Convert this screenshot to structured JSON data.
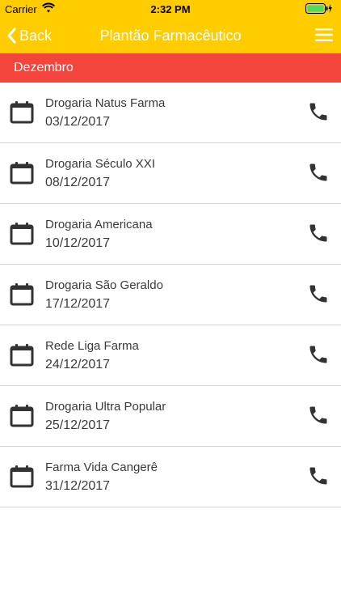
{
  "status": {
    "carrier": "Carrier",
    "time": "2:32 PM"
  },
  "nav": {
    "back_label": "Back",
    "title": "Plantão Farmacêutico"
  },
  "section": {
    "month": "Dezembro"
  },
  "colors": {
    "bar": "#FFCC00",
    "section": "#F3453B"
  },
  "items": [
    {
      "name": "Drogaria Natus Farma",
      "date": "03/12/2017"
    },
    {
      "name": "Drogaria Século XXI",
      "date": "08/12/2017"
    },
    {
      "name": "Drogaria Americana",
      "date": "10/12/2017"
    },
    {
      "name": "Drogaria São Geraldo",
      "date": "17/12/2017"
    },
    {
      "name": "Rede Liga Farma",
      "date": "24/12/2017"
    },
    {
      "name": "Drogaria Ultra Popular",
      "date": "25/12/2017"
    },
    {
      "name": "Farma Vida Cangerê",
      "date": "31/12/2017"
    }
  ]
}
